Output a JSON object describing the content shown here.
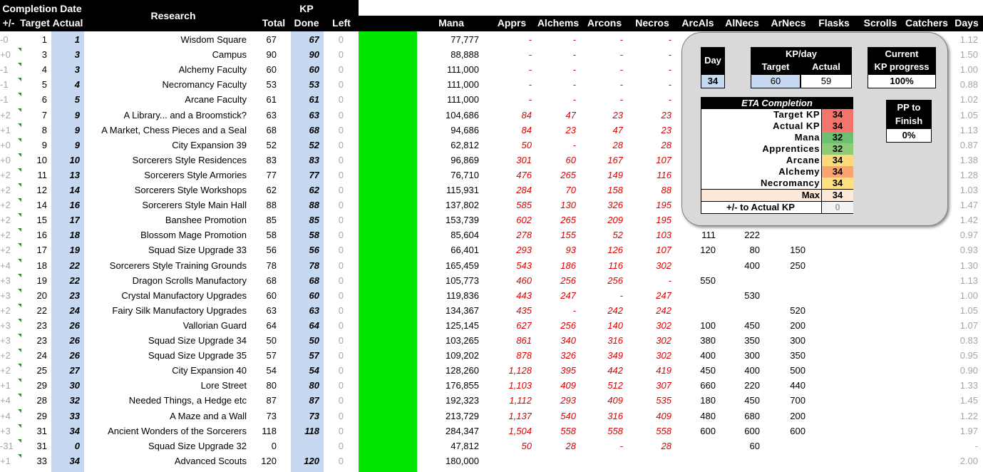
{
  "header": {
    "completion_date": "Completion Date",
    "pm": "+/-",
    "target": "Target",
    "actual": "Actual",
    "research": "Research",
    "total": "Total",
    "kp": "KP",
    "done": "Done",
    "left": "Left",
    "mana": "Mana",
    "apprs": "Apprs",
    "alchems": "Alchems",
    "arcons": "Arcons",
    "necros": "Necros",
    "arcals": "ArcAls",
    "alnecs": "AlNecs",
    "arnecs": "ArNecs",
    "flasks": "Flasks",
    "scrolls": "Scrolls",
    "catchers": "Catchers",
    "days": "Days"
  },
  "rows": [
    {
      "pm": "-0",
      "target": "1",
      "actual": "1",
      "research": "Wisdom Square",
      "total": "67",
      "done": "67",
      "left": "0",
      "mana": "77,777",
      "apprs": "-",
      "alchems": "-",
      "arcons": "-",
      "necros": "-",
      "arcals": "",
      "alnecs": "",
      "arnecs": "",
      "days": "1.12"
    },
    {
      "pm": "+0",
      "target": "3",
      "actual": "3",
      "research": "Campus",
      "total": "90",
      "done": "90",
      "left": "0",
      "mana": "88,888",
      "apprs": "-",
      "alchems": "-",
      "arcons": "-",
      "necros": "-",
      "arcals": "",
      "alnecs": "",
      "arnecs": "",
      "days": "1.50"
    },
    {
      "pm": "-1",
      "target": "4",
      "actual": "3",
      "research": "Alchemy Faculty",
      "total": "60",
      "done": "60",
      "left": "0",
      "mana": "111,000",
      "apprs": "-",
      "alchems": "-",
      "arcons": "-",
      "necros": "-",
      "arcals": "",
      "alnecs": "",
      "arnecs": "",
      "days": "1.00"
    },
    {
      "pm": "-1",
      "target": "5",
      "actual": "4",
      "research": "Necromancy Faculty",
      "total": "53",
      "done": "53",
      "left": "0",
      "mana": "111,000",
      "apprs": "-",
      "alchems": "-",
      "arcons": "-",
      "necros": "-",
      "arcals": "",
      "alnecs": "",
      "arnecs": "",
      "days": "0.88"
    },
    {
      "pm": "-1",
      "target": "6",
      "actual": "5",
      "research": "Arcane Faculty",
      "total": "61",
      "done": "61",
      "left": "0",
      "mana": "111,000",
      "apprs": "-",
      "alchems": "-",
      "arcons": "-",
      "necros": "-",
      "arcals": "",
      "alnecs": "",
      "arnecs": "",
      "days": "1.02"
    },
    {
      "pm": "+2",
      "target": "7",
      "actual": "9",
      "research": "A Library... and a Broomstick?",
      "total": "63",
      "done": "63",
      "left": "0",
      "mana": "104,686",
      "apprs": "84",
      "alchems": "47",
      "arcons": "23",
      "necros": "23",
      "arcals": "",
      "alnecs": "",
      "arnecs": "",
      "days": "1.05"
    },
    {
      "pm": "+1",
      "target": "8",
      "actual": "9",
      "research": "A Market, Chess Pieces and a Seal",
      "total": "68",
      "done": "68",
      "left": "0",
      "mana": "94,686",
      "apprs": "84",
      "alchems": "23",
      "arcons": "47",
      "necros": "23",
      "arcals": "",
      "alnecs": "",
      "arnecs": "",
      "days": "1.13"
    },
    {
      "pm": "+0",
      "target": "9",
      "actual": "9",
      "research": "City Expansion 39",
      "total": "52",
      "done": "52",
      "left": "0",
      "mana": "62,812",
      "apprs": "50",
      "alchems": "-",
      "arcons": "28",
      "necros": "28",
      "arcals": "",
      "alnecs": "",
      "arnecs": "",
      "days": "0.87"
    },
    {
      "pm": "+0",
      "target": "10",
      "actual": "10",
      "research": "Sorcerers Style Residences",
      "total": "83",
      "done": "83",
      "left": "0",
      "mana": "96,869",
      "apprs": "301",
      "alchems": "60",
      "arcons": "167",
      "necros": "107",
      "arcals": "",
      "alnecs": "",
      "arnecs": "",
      "days": "1.38"
    },
    {
      "pm": "+2",
      "target": "11",
      "actual": "13",
      "research": "Sorcerers Style Armories",
      "total": "77",
      "done": "77",
      "left": "0",
      "mana": "76,710",
      "apprs": "476",
      "alchems": "265",
      "arcons": "149",
      "necros": "116",
      "arcals": "",
      "alnecs": "",
      "arnecs": "",
      "days": "1.28"
    },
    {
      "pm": "+2",
      "target": "12",
      "actual": "14",
      "research": "Sorcerers Style Workshops",
      "total": "62",
      "done": "62",
      "left": "0",
      "mana": "115,931",
      "apprs": "284",
      "alchems": "70",
      "arcons": "158",
      "necros": "88",
      "arcals": "",
      "alnecs": "",
      "arnecs": "",
      "days": "1.03"
    },
    {
      "pm": "+2",
      "target": "14",
      "actual": "16",
      "research": "Sorcerers Style Main Hall",
      "total": "88",
      "done": "88",
      "left": "0",
      "mana": "137,802",
      "apprs": "585",
      "alchems": "130",
      "arcons": "326",
      "necros": "195",
      "arcals": "",
      "alnecs": "",
      "arnecs": "",
      "days": "1.47"
    },
    {
      "pm": "+2",
      "target": "15",
      "actual": "17",
      "research": "Banshee Promotion",
      "total": "85",
      "done": "85",
      "left": "0",
      "mana": "153,739",
      "apprs": "602",
      "alchems": "265",
      "arcons": "209",
      "necros": "195",
      "arcals": "",
      "alnecs": "",
      "arnecs": "",
      "days": "1.42"
    },
    {
      "pm": "+2",
      "target": "16",
      "actual": "18",
      "research": "Blossom Mage Promotion",
      "total": "58",
      "done": "58",
      "left": "0",
      "mana": "85,604",
      "apprs": "278",
      "alchems": "155",
      "arcons": "52",
      "necros": "103",
      "arcals": "111",
      "alnecs": "222",
      "arnecs": "",
      "days": "0.97"
    },
    {
      "pm": "+2",
      "target": "17",
      "actual": "19",
      "research": "Squad Size Upgrade 33",
      "total": "56",
      "done": "56",
      "left": "0",
      "mana": "66,401",
      "apprs": "293",
      "alchems": "93",
      "arcons": "126",
      "necros": "107",
      "arcals": "120",
      "alnecs": "80",
      "arnecs": "150",
      "days": "0.93"
    },
    {
      "pm": "+4",
      "target": "18",
      "actual": "22",
      "research": "Sorcerers Style Training Grounds",
      "total": "78",
      "done": "78",
      "left": "0",
      "mana": "165,459",
      "apprs": "543",
      "alchems": "186",
      "arcons": "116",
      "necros": "302",
      "arcals": "",
      "alnecs": "400",
      "arnecs": "250",
      "days": "1.30"
    },
    {
      "pm": "+3",
      "target": "19",
      "actual": "22",
      "research": "Dragon Scrolls Manufactory",
      "total": "68",
      "done": "68",
      "left": "0",
      "mana": "105,773",
      "apprs": "460",
      "alchems": "256",
      "arcons": "256",
      "necros": "-",
      "arcals": "550",
      "alnecs": "",
      "arnecs": "",
      "days": "1.13"
    },
    {
      "pm": "+3",
      "target": "20",
      "actual": "23",
      "research": "Crystal Manufactory Upgrades",
      "total": "60",
      "done": "60",
      "left": "0",
      "mana": "119,836",
      "apprs": "443",
      "alchems": "247",
      "arcons": "-",
      "necros": "247",
      "arcals": "",
      "alnecs": "530",
      "arnecs": "",
      "days": "1.00"
    },
    {
      "pm": "+2",
      "target": "22",
      "actual": "24",
      "research": "Fairy Silk Manufactory Upgrades",
      "total": "63",
      "done": "63",
      "left": "0",
      "mana": "134,367",
      "apprs": "435",
      "alchems": "-",
      "arcons": "242",
      "necros": "242",
      "arcals": "",
      "alnecs": "",
      "arnecs": "520",
      "days": "1.05"
    },
    {
      "pm": "+3",
      "target": "23",
      "actual": "26",
      "research": "Vallorian Guard",
      "total": "64",
      "done": "64",
      "left": "0",
      "mana": "125,145",
      "apprs": "627",
      "alchems": "256",
      "arcons": "140",
      "necros": "302",
      "arcals": "100",
      "alnecs": "450",
      "arnecs": "200",
      "days": "1.07"
    },
    {
      "pm": "+3",
      "target": "23",
      "actual": "26",
      "research": "Squad Size Upgrade 34",
      "total": "50",
      "done": "50",
      "left": "0",
      "mana": "103,265",
      "apprs": "861",
      "alchems": "340",
      "arcons": "316",
      "necros": "302",
      "arcals": "380",
      "alnecs": "350",
      "arnecs": "300",
      "days": "0.83"
    },
    {
      "pm": "+2",
      "target": "24",
      "actual": "26",
      "research": "Squad Size Upgrade 35",
      "total": "57",
      "done": "57",
      "left": "0",
      "mana": "109,202",
      "apprs": "878",
      "alchems": "326",
      "arcons": "349",
      "necros": "302",
      "arcals": "400",
      "alnecs": "300",
      "arnecs": "350",
      "days": "0.95"
    },
    {
      "pm": "+2",
      "target": "25",
      "actual": "27",
      "research": "City Expansion 40",
      "total": "54",
      "done": "54",
      "left": "0",
      "mana": "128,260",
      "apprs": "1,128",
      "alchems": "395",
      "arcons": "442",
      "necros": "419",
      "arcals": "450",
      "alnecs": "400",
      "arnecs": "500",
      "days": "0.90"
    },
    {
      "pm": "+1",
      "target": "29",
      "actual": "30",
      "research": "Lore Street",
      "total": "80",
      "done": "80",
      "left": "0",
      "mana": "176,855",
      "apprs": "1,103",
      "alchems": "409",
      "arcons": "512",
      "necros": "307",
      "arcals": "660",
      "alnecs": "220",
      "arnecs": "440",
      "days": "1.33"
    },
    {
      "pm": "+4",
      "target": "28",
      "actual": "32",
      "research": "Needed Things, a Hedge etc",
      "total": "87",
      "done": "87",
      "left": "0",
      "mana": "192,323",
      "apprs": "1,112",
      "alchems": "293",
      "arcons": "409",
      "necros": "535",
      "arcals": "180",
      "alnecs": "450",
      "arnecs": "700",
      "days": "1.45"
    },
    {
      "pm": "+4",
      "target": "29",
      "actual": "33",
      "research": "A Maze and a Wall",
      "total": "73",
      "done": "73",
      "left": "0",
      "mana": "213,729",
      "apprs": "1,137",
      "alchems": "540",
      "arcons": "316",
      "necros": "409",
      "arcals": "480",
      "alnecs": "680",
      "arnecs": "200",
      "days": "1.22"
    },
    {
      "pm": "+3",
      "target": "31",
      "actual": "34",
      "research": "Ancient Wonders of the Sorcerers",
      "total": "118",
      "done": "118",
      "left": "0",
      "mana": "284,347",
      "apprs": "1,504",
      "alchems": "558",
      "arcons": "558",
      "necros": "558",
      "arcals": "600",
      "alnecs": "600",
      "arnecs": "600",
      "days": "1.97"
    },
    {
      "pm": "-31",
      "target": "31",
      "actual": "0",
      "research": "Squad Size Upgrade 32",
      "total": "0",
      "done": "",
      "left": "0",
      "mana": "47,812",
      "apprs": "50",
      "alchems": "28",
      "arcons": "-",
      "necros": "28",
      "arcals": "",
      "alnecs": "60",
      "arnecs": "",
      "days": "-"
    },
    {
      "pm": "+1",
      "target": "33",
      "actual": "34",
      "research": "Advanced Scouts",
      "total": "120",
      "done": "120",
      "left": "0",
      "mana": "180,000",
      "apprs": "",
      "alchems": "",
      "arcons": "",
      "necros": "",
      "arcals": "",
      "alnecs": "",
      "arnecs": "",
      "days": "2.00"
    }
  ],
  "dashboard": {
    "day_label": "Day",
    "day_value": "34",
    "kpday_label": "KP/day",
    "kpday_target_label": "Target",
    "kpday_actual_label": "Actual",
    "kpday_target": "60",
    "kpday_actual": "59",
    "current_label_1": "Current",
    "current_label_2": "KP progress",
    "current_value": "100%",
    "eta_title": "ETA Completion",
    "eta_rows": [
      {
        "label": "Target KP",
        "value": "34",
        "color": "#f4736b"
      },
      {
        "label": "Actual KP",
        "value": "34",
        "color": "#f4736b"
      },
      {
        "label": "Mana",
        "value": "32",
        "color": "#6cc070"
      },
      {
        "label": "Apprentices",
        "value": "32",
        "color": "#8fcb76"
      },
      {
        "label": "Arcane",
        "value": "34",
        "color": "#fed97a"
      },
      {
        "label": "Alchemy",
        "value": "34",
        "color": "#fba46f"
      },
      {
        "label": "Necromancy",
        "value": "34",
        "color": "#fde07f"
      }
    ],
    "eta_max_label": "Max",
    "eta_max_value": "34",
    "eta_pm_label": "+/- to Actual KP",
    "eta_pm_value": "0",
    "pp_label_1": "PP to",
    "pp_label_2": "Finish",
    "pp_value": "0%"
  },
  "colors": {
    "header_bg": "#000000",
    "kp_blue": "#c6d9f0",
    "green_bar": "#00e600",
    "red_text": "#e00000",
    "gray_text": "#a6a6a6",
    "dash_bg": "#d9d9d9"
  }
}
